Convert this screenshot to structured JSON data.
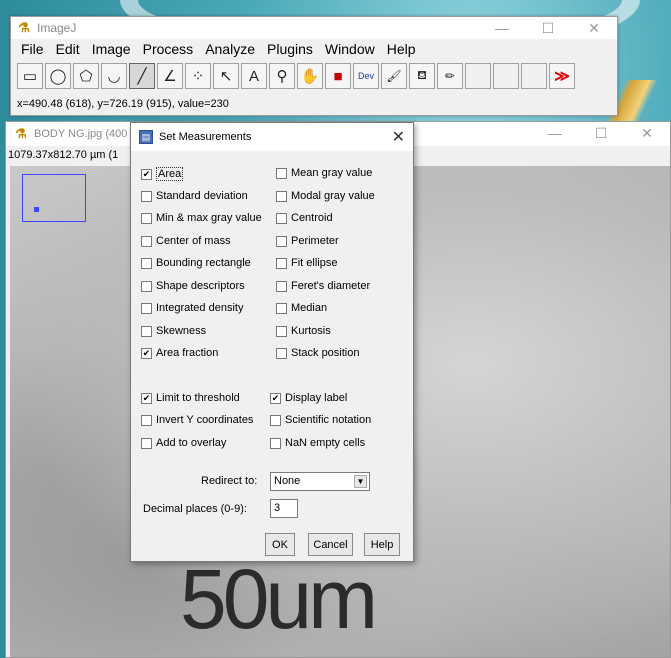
{
  "main_window": {
    "title": "ImageJ",
    "controls": [
      "—",
      "☐",
      "✕"
    ],
    "menu": [
      "File",
      "Edit",
      "Image",
      "Process",
      "Analyze",
      "Plugins",
      "Window",
      "Help"
    ],
    "tools": [
      {
        "name": "rectangle-tool",
        "glyph": "▭"
      },
      {
        "name": "oval-tool",
        "glyph": "◯"
      },
      {
        "name": "polygon-tool",
        "glyph": "⬠"
      },
      {
        "name": "freehand-tool",
        "glyph": "◡"
      },
      {
        "name": "line-tool",
        "glyph": "╱"
      },
      {
        "name": "angle-tool",
        "glyph": "∠"
      },
      {
        "name": "point-tool",
        "glyph": "⁘"
      },
      {
        "name": "wand-tool",
        "glyph": "↖"
      },
      {
        "name": "text-tool",
        "glyph": "A"
      },
      {
        "name": "magnifier-tool",
        "glyph": "⚲"
      },
      {
        "name": "hand-tool",
        "glyph": "✋"
      },
      {
        "name": "color-picker-tool",
        "glyph": "■"
      },
      {
        "name": "developer-menu-tool",
        "glyph": "Dev"
      },
      {
        "name": "brush-tool",
        "glyph": "🖌"
      },
      {
        "name": "flood-fill-tool",
        "glyph": "⛾"
      },
      {
        "name": "pencil-tool",
        "glyph": "✏"
      }
    ],
    "more_tools": "≫",
    "status": "x=490.48 (618), y=726.19 (915), value=230"
  },
  "image_window": {
    "title": "BODY NG.jpg (400",
    "info": "1079.37x812.70 µm (1",
    "scalebar_text": "50um",
    "controls": [
      "—",
      "☐",
      "✕"
    ]
  },
  "dialog": {
    "title": "Set Measurements",
    "close": "✕",
    "left_options": [
      {
        "label": "Area",
        "checked": true
      },
      {
        "label": "Standard deviation",
        "checked": false
      },
      {
        "label": "Min & max gray value",
        "checked": false
      },
      {
        "label": "Center of mass",
        "checked": false
      },
      {
        "label": "Bounding rectangle",
        "checked": false
      },
      {
        "label": "Shape descriptors",
        "checked": false
      },
      {
        "label": "Integrated density",
        "checked": false
      },
      {
        "label": "Skewness",
        "checked": false
      },
      {
        "label": "Area fraction",
        "checked": true
      }
    ],
    "right_options": [
      {
        "label": "Mean gray value",
        "checked": false
      },
      {
        "label": "Modal gray value",
        "checked": false
      },
      {
        "label": "Centroid",
        "checked": false
      },
      {
        "label": "Perimeter",
        "checked": false
      },
      {
        "label": "Fit ellipse",
        "checked": false
      },
      {
        "label": "Feret's diameter",
        "checked": false
      },
      {
        "label": "Median",
        "checked": false
      },
      {
        "label": "Kurtosis",
        "checked": false
      },
      {
        "label": "Stack position",
        "checked": false
      }
    ],
    "left_options2": [
      {
        "label": "Limit to threshold",
        "checked": true
      },
      {
        "label": "Invert Y coordinates",
        "checked": false
      },
      {
        "label": "Add to overlay",
        "checked": false
      }
    ],
    "right_options2": [
      {
        "label": "Display label",
        "checked": true
      },
      {
        "label": "Scientific notation",
        "checked": false
      },
      {
        "label": "NaN empty cells",
        "checked": false
      }
    ],
    "redirect_label": "Redirect to:",
    "redirect_value": "None",
    "decimal_label": "Decimal places (0-9):",
    "decimal_value": "3",
    "buttons": {
      "ok": "OK",
      "cancel": "Cancel",
      "help": "Help"
    }
  }
}
